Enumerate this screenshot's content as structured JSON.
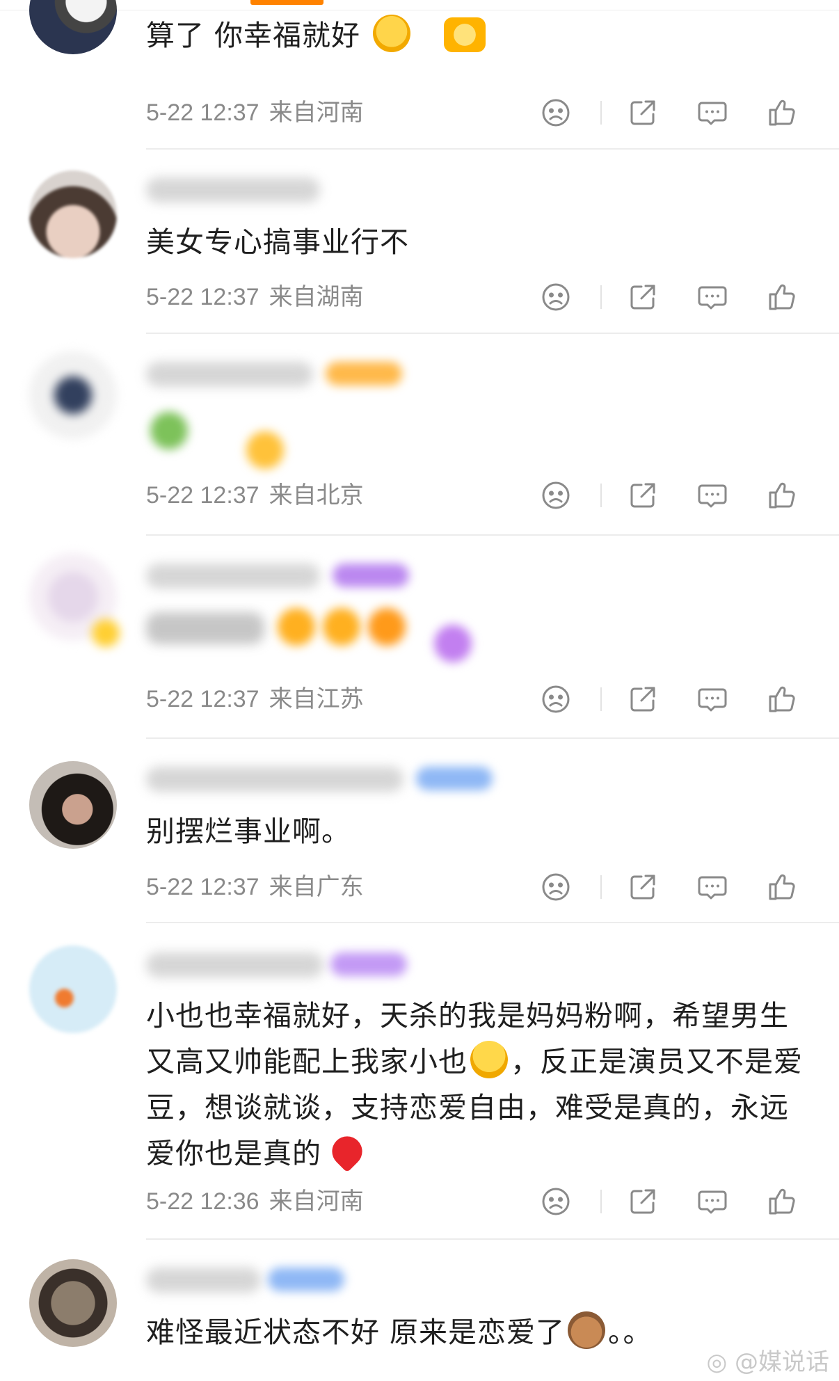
{
  "comments": [
    {
      "username": "",
      "text": "算了 你幸福就好",
      "emoji": "loudly-crying-emoji",
      "date": "5-22 12:37",
      "source": "来自河南"
    },
    {
      "username": "",
      "text": "美女专心搞事业行不",
      "date": "5-22 12:37",
      "source": "来自湖南"
    },
    {
      "username": "",
      "text": "",
      "date": "5-22 12:37",
      "source": "来自北京"
    },
    {
      "username": "",
      "text": "",
      "date": "5-22 12:37",
      "source": "来自江苏"
    },
    {
      "username": "",
      "text": "别摆烂事业啊。",
      "date": "5-22 12:37",
      "source": "来自广东"
    },
    {
      "username": "",
      "text_parts": [
        "小也也幸福就好，天杀的我是妈妈粉啊，希望男生又高又帅能配上我家小也",
        "，反正是演员又不是爱豆，想谈就谈，支持恋爱自由，难受是真的，永远爱你也是真的"
      ],
      "emojis": [
        "crying-hands-emoji",
        "red-heart-emoji"
      ],
      "date": "5-22 12:36",
      "source": "来自河南"
    },
    {
      "username": "",
      "text": "难怪最近状态不好 原来是恋爱了",
      "suffix": "。。",
      "emoji": "capybara-emoji"
    }
  ],
  "actions": [
    "dislike-icon",
    "share-icon",
    "comment-icon",
    "like-icon"
  ],
  "watermark": "@媒说话",
  "colors": {
    "accent": "#ff8200",
    "meta_text": "#8a8a8a",
    "icon": "#8a8a8a",
    "divider": "#ececec"
  }
}
